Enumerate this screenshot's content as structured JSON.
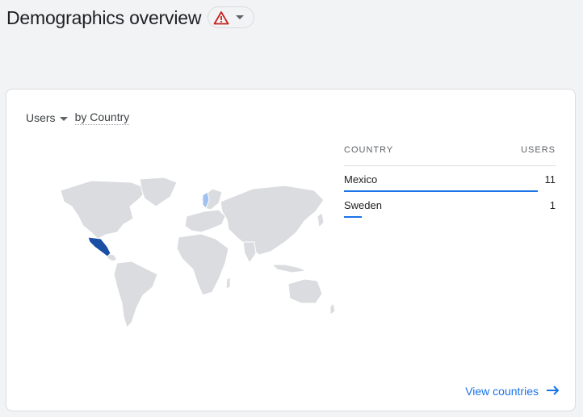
{
  "page": {
    "title": "Demographics overview"
  },
  "chip": {
    "icon": "warning-icon",
    "accent": "#c5221f"
  },
  "card": {
    "metric": "Users",
    "dimension": "by Country",
    "table": {
      "col_country": "COUNTRY",
      "col_users": "USERS",
      "rows": [
        {
          "country": "Mexico",
          "users": "11",
          "share": 1.0
        },
        {
          "country": "Sweden",
          "users": "1",
          "share": 0.09
        }
      ]
    },
    "map_colors": {
      "land": "#dadce0",
      "mexico": "#1a4fa5",
      "sweden": "#9ec1f2"
    },
    "view_link": "View countries"
  }
}
